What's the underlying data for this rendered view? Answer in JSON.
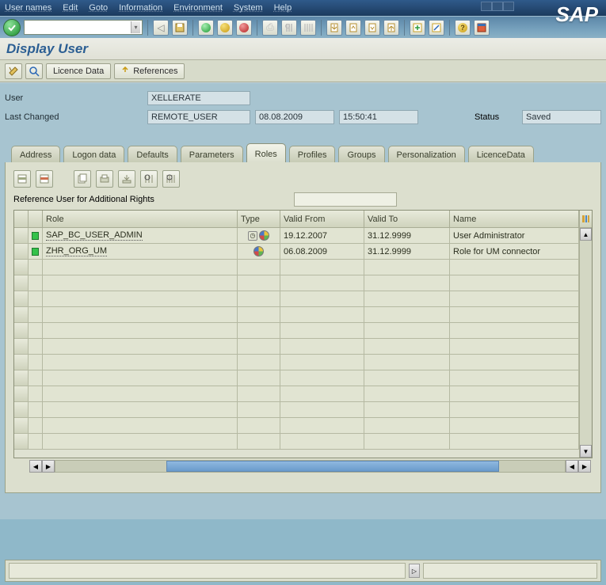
{
  "menu": {
    "user_names": "User names",
    "edit": "Edit",
    "goto": "Goto",
    "information": "Information",
    "environment": "Environment",
    "system": "System",
    "help": "Help"
  },
  "brand": "SAP",
  "page_title": "Display User",
  "app_toolbar": {
    "licence": "Licence Data",
    "references": "References"
  },
  "header": {
    "user_label": "User",
    "user_value": "XELLERATE",
    "last_changed_label": "Last Changed",
    "changed_by": "REMOTE_USER",
    "changed_date": "08.08.2009",
    "changed_time": "15:50:41",
    "status_label": "Status",
    "status_value": "Saved"
  },
  "tabs": [
    "Address",
    "Logon data",
    "Defaults",
    "Parameters",
    "Roles",
    "Profiles",
    "Groups",
    "Personalization",
    "LicenceData"
  ],
  "active_tab": 4,
  "roles_panel": {
    "ref_label": "Reference User for Additional Rights",
    "columns": {
      "role": "Role",
      "type": "Type",
      "from": "Valid From",
      "to": "Valid To",
      "name": "Name"
    },
    "rows": [
      {
        "role": "SAP_BC_USER_ADMIN",
        "from": "19.12.2007",
        "to": "31.12.9999",
        "name": "User Administrator",
        "type_extra": true
      },
      {
        "role": "ZHR_ORG_UM",
        "from": "06.08.2009",
        "to": "31.12.9999",
        "name": "Role for UM connector",
        "type_extra": false
      }
    ]
  }
}
